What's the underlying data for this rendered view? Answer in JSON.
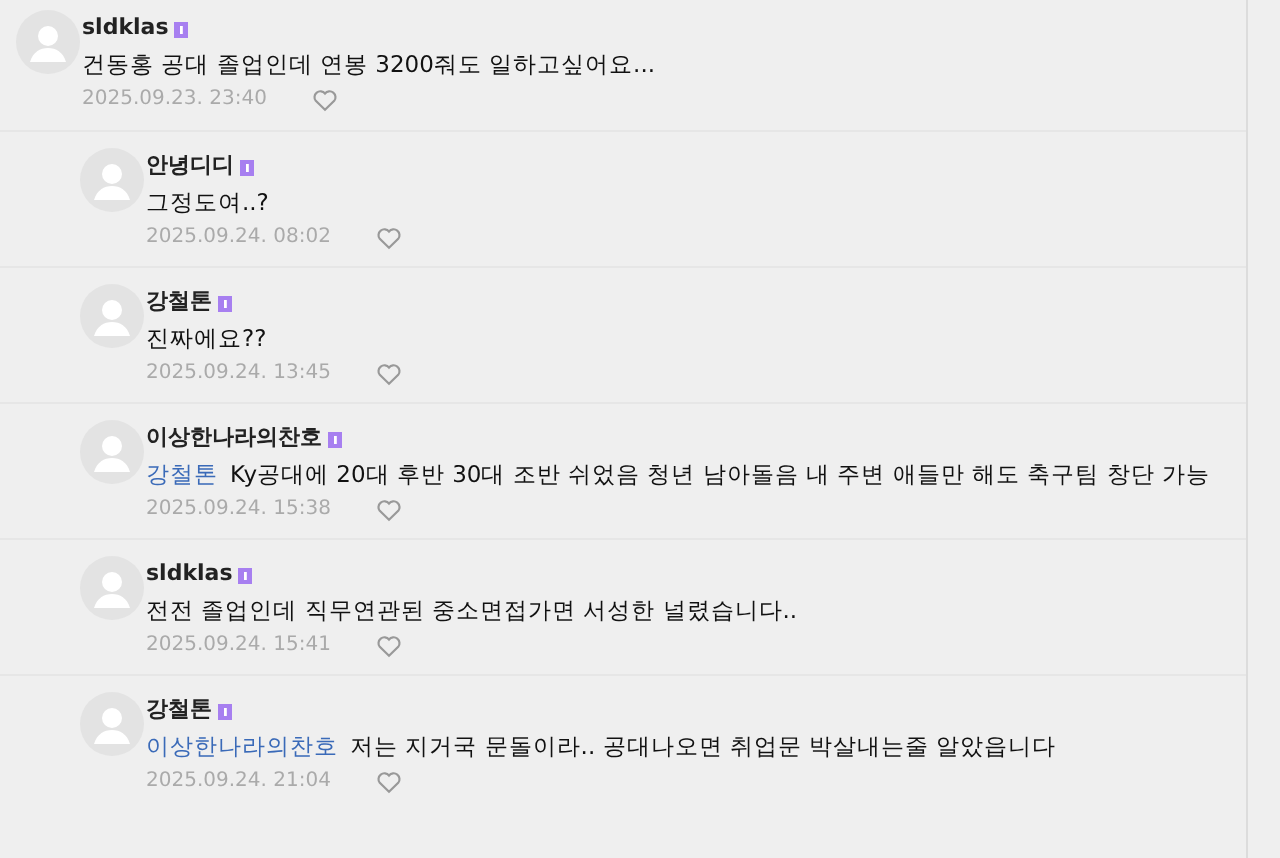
{
  "comments": [
    {
      "author": "sldklas",
      "text": "건동홍 공대 졸업인데 연봉 3200줘도 일하고싶어요...",
      "date": "2025.09.23. 23:40",
      "children": [
        {
          "author": "안녕디디",
          "text": "그정도여..?",
          "date": "2025.09.24. 08:02"
        },
        {
          "author": "강철톤",
          "text": "진짜에요??",
          "date": "2025.09.24. 13:45"
        },
        {
          "author": "이상한나라의찬호",
          "mention": "강철톤",
          "text": "Ky공대에 20대 후반 30대 조반 쉬었음 청년 남아돌음 내 주변 애들만 해도 축구팀 창단 가능",
          "date": "2025.09.24. 15:38"
        },
        {
          "author": "sldklas",
          "text": "전전 졸업인데 직무연관된 중소면접가면 서성한 널렸습니다..",
          "date": "2025.09.24. 15:41"
        },
        {
          "author": "강철톤",
          "mention": "이상한나라의찬호",
          "text": "저는 지거국 문돌이라.. 공대나오면 취업문 박살내는줄 알았읍니다",
          "date": "2025.09.24. 21:04"
        }
      ]
    }
  ]
}
